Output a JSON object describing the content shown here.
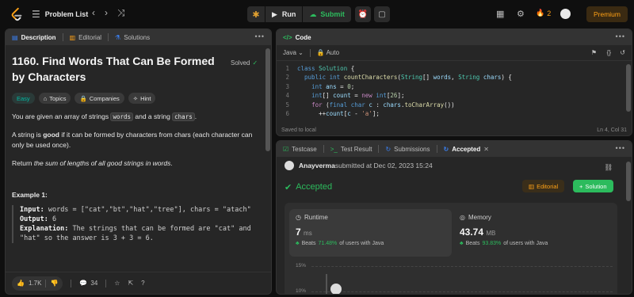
{
  "topbar": {
    "problem_list_label": "Problem List",
    "run_label": "Run",
    "submit_label": "Submit",
    "streak_count": "2",
    "premium_label": "Premium"
  },
  "left": {
    "tabs": [
      {
        "label": "Description"
      },
      {
        "label": "Editorial"
      },
      {
        "label": "Solutions"
      }
    ],
    "title": "1160. Find Words That Can Be Formed by Characters",
    "solved_label": "Solved",
    "pills": [
      "Easy",
      "Topics",
      "Companies",
      "Hint"
    ],
    "p1_pre": "You are given an array of strings ",
    "p1_code1": "words",
    "p1_mid": " and a string ",
    "p1_code2": "chars",
    "p1_post": ".",
    "p2_pre": "A string is ",
    "p2_bold": "good",
    "p2_post": " if it can be formed by characters from chars (each character can only be used once).",
    "p3_pre": "Return ",
    "p3_em": "the sum of lengths of all good strings in words",
    "p3_post": ".",
    "example_title": "Example 1:",
    "ex_input_label": "Input:",
    "ex_input": " words = [\"cat\",\"bt\",\"hat\",\"tree\"], chars = \"atach\"",
    "ex_output_label": "Output:",
    "ex_output": " 6",
    "ex_expl_label": "Explanation:",
    "ex_expl": " The strings that can be formed are \"cat\" and \"hat\" so the answer is 3 + 3 = 6.",
    "likes": "1.7K",
    "comments": "34"
  },
  "code": {
    "tab_label": "Code",
    "language": "Java",
    "auto_label": "Auto",
    "saved_label": "Saved to local",
    "cursor_pos": "Ln 4, Col 31"
  },
  "result": {
    "tabs": [
      {
        "label": "Testcase"
      },
      {
        "label": "Test Result"
      },
      {
        "label": "Submissions"
      },
      {
        "label": "Accepted"
      }
    ],
    "user": "Anayverma",
    "submitted_text": " submitted at Dec 02, 2023 15:24",
    "status": "Accepted",
    "editorial_label": "Editorial",
    "solution_label": "Solution",
    "runtime_label": "Runtime",
    "runtime_value": "7",
    "runtime_unit": "ms",
    "runtime_beats_pre": "Beats ",
    "runtime_beats_pct": "71.48%",
    "runtime_beats_post": " of users with Java",
    "memory_label": "Memory",
    "memory_value": "43.74",
    "memory_unit": "MB",
    "memory_beats_pre": "Beats ",
    "memory_beats_pct": "93.83%",
    "memory_beats_post": " of users with Java",
    "axis_15": "15%",
    "axis_10": "10%"
  },
  "colors": {
    "accent_green": "#2cbb5d",
    "accent_orange": "#ffa116",
    "easy_teal": "#00b8a3"
  }
}
